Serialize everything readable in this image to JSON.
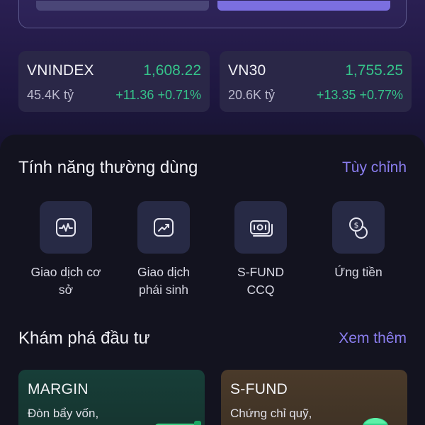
{
  "indices": [
    {
      "name": "VNINDEX",
      "value": "1,608.22",
      "volume": "45.4K tỷ",
      "change": "+11.36 +0.71%"
    },
    {
      "name": "VN30",
      "value": "1,755.25",
      "volume": "20.6K tỷ",
      "change": "+13.35 +0.77%"
    }
  ],
  "features_section": {
    "title": "Tính năng thường dùng",
    "customize_label": "Tùy chỉnh",
    "items": [
      {
        "line1": "Giao dịch cơ",
        "line2": "sở",
        "icon": "chart-line-icon"
      },
      {
        "line1": "Giao dịch",
        "line2": "phái sinh",
        "icon": "trend-up-icon"
      },
      {
        "line1": "S-FUND",
        "line2": "CCQ",
        "icon": "money-stack-icon"
      },
      {
        "line1": "Ứng tiền",
        "line2": "",
        "icon": "coins-icon"
      }
    ]
  },
  "explore_section": {
    "title": "Khám phá đầu tư",
    "more_label": "Xem thêm",
    "cards": [
      {
        "title": "MARGIN",
        "desc": "Đòn bẩy vốn,"
      },
      {
        "title": "S-FUND",
        "desc": "Chứng chỉ quỹ,"
      }
    ]
  },
  "colors": {
    "accent": "#8b7ef0",
    "positive": "#35c48a",
    "card_bg": "#2a2747",
    "panel_bg": "#13131f"
  }
}
